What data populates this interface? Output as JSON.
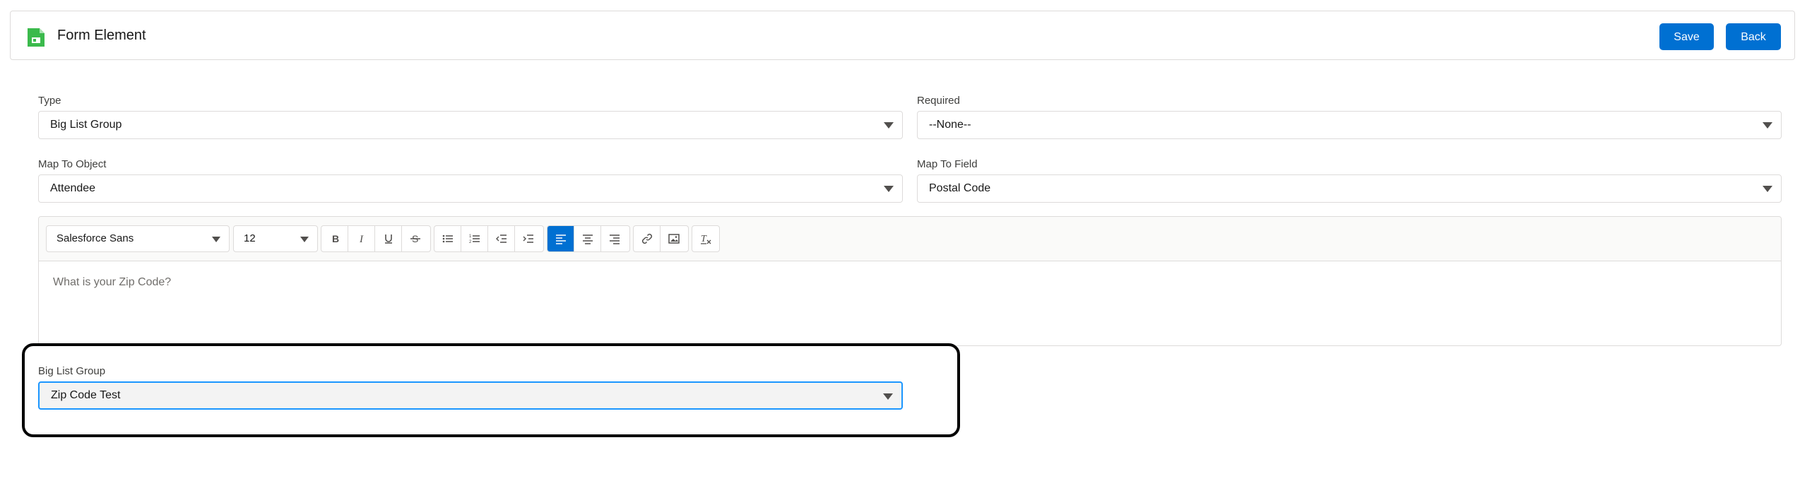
{
  "header": {
    "title": "Form Element",
    "icon": "form-document-icon",
    "icon_color": "#3bba4c",
    "save_label": "Save",
    "back_label": "Back"
  },
  "fields": {
    "type": {
      "label": "Type",
      "value": "Big List Group"
    },
    "required": {
      "label": "Required",
      "value": "--None--"
    },
    "map_to_object": {
      "label": "Map To Object",
      "value": "Attendee"
    },
    "map_to_field": {
      "label": "Map To Field",
      "value": "Postal Code"
    },
    "big_list_group": {
      "label": "Big List Group",
      "value": "Zip Code Test"
    }
  },
  "editor": {
    "font_family": "Salesforce Sans",
    "font_size": "12",
    "content": "What is your Zip Code?",
    "toolbar_icons": [
      "bold-icon",
      "italic-icon",
      "underline-icon",
      "strikethrough-icon",
      "bullet-list-icon",
      "numbered-list-icon",
      "outdent-icon",
      "indent-icon",
      "align-left-icon",
      "align-center-icon",
      "align-right-icon",
      "link-icon",
      "image-icon",
      "clear-formatting-icon"
    ],
    "active_alignment": "left"
  },
  "colors": {
    "accent": "#0070d2",
    "focus_border": "#1b96ff",
    "highlight_border": "#000000"
  }
}
